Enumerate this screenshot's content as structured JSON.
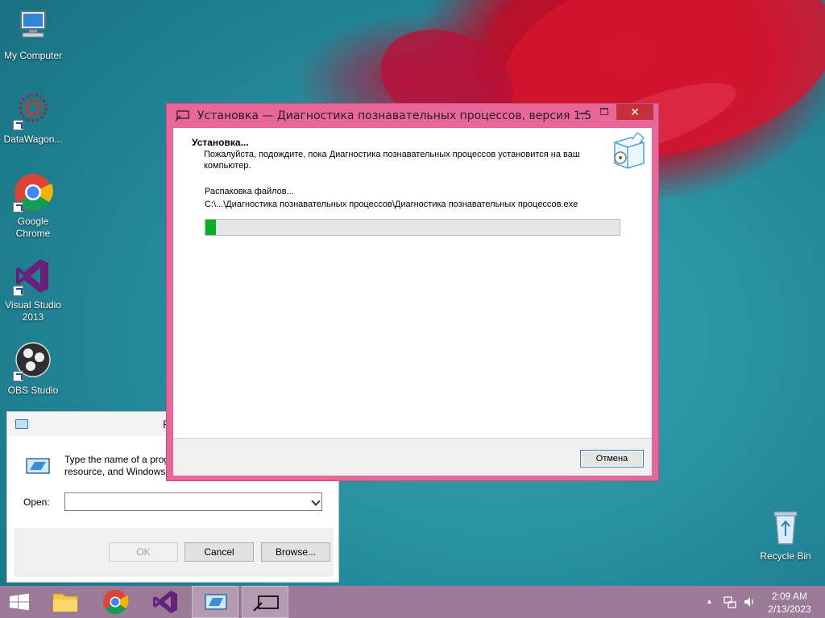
{
  "desktop": {
    "icons": [
      {
        "label": "My Computer"
      },
      {
        "label": "DataWagon..."
      },
      {
        "label": "Google Chrome"
      },
      {
        "label": "Visual Studio 2013"
      },
      {
        "label": "OBS Studio"
      },
      {
        "label": "Recycle Bin"
      }
    ]
  },
  "setup_window": {
    "title": "Установка — Диагностика познавательных процессов, версия 1.5",
    "heading": "Установка...",
    "subtext": "Пожалуйста, подождите, пока Диагностика познавательных процессов установится на ваш компьютер.",
    "status": "Распаковка файлов...",
    "filepath": "C:\\...\\Диагностика познавательных процессов\\Диагностика познавательных процессов.exe",
    "progress_percent": 2.5,
    "cancel_label": "Отмена",
    "close_glyph": "✕"
  },
  "run_dialog": {
    "title": "R",
    "desc_line1": "Type the name of a prog",
    "desc_line2": "resource, and Windows",
    "open_label": "Open:",
    "open_value": "",
    "ok_label": "OK",
    "cancel_label": "Cancel",
    "browse_label": "Browse..."
  },
  "taskbar": {
    "time": "2:09 AM",
    "date": "2/13/2023",
    "tray_arrow": "▲"
  },
  "colors": {
    "window_frame": "#e8679a",
    "close_button": "#c7303a",
    "progress_fill": "#06b025",
    "taskbar": "#9b7a97"
  }
}
